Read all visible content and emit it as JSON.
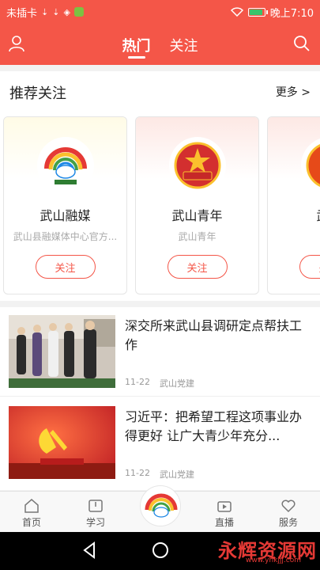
{
  "statusbar": {
    "carrier": "未插卡",
    "time": "晚上7:10"
  },
  "header": {
    "tabs": [
      {
        "label": "热门",
        "active": true
      },
      {
        "label": "关注",
        "active": false
      }
    ]
  },
  "recommend": {
    "title": "推荐关注",
    "more": "更多 >",
    "cards": [
      {
        "name": "武山融媒",
        "desc": "武山县融媒体中心官方...",
        "follow": "关注"
      },
      {
        "name": "武山青年",
        "desc": "武山青年",
        "follow": "关注"
      },
      {
        "name": "武山",
        "desc": "武山",
        "follow": "关注"
      }
    ]
  },
  "news": [
    {
      "title": "深交所来武山县调研定点帮扶工作",
      "date": "11-22",
      "source": "武山党建"
    },
    {
      "title": "习近平：把希望工程这项事业办得更好 让广大青少年充分...",
      "date": "11-22",
      "source": "武山党建"
    }
  ],
  "bottomnav": {
    "items": [
      {
        "label": "首页",
        "icon": "home-icon"
      },
      {
        "label": "学习",
        "icon": "book-icon"
      },
      {
        "label": "直播",
        "icon": "live-icon"
      },
      {
        "label": "服务",
        "icon": "heart-icon"
      }
    ]
  },
  "watermark": {
    "text": "永辉资源网",
    "url": "www.yhkjjj.com"
  },
  "colors": {
    "accent": "#f45648"
  }
}
